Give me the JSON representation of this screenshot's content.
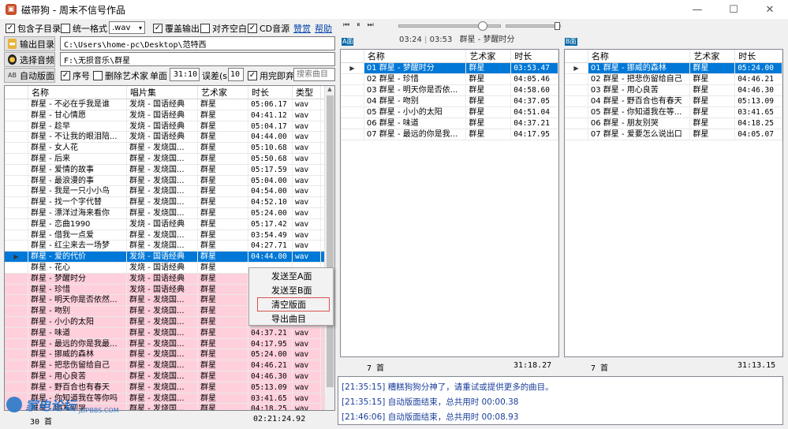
{
  "window": {
    "title": "磁带狗 - 周末不信号作品",
    "app_icon": "cassette-icon",
    "controls": [
      "—",
      "☐",
      "✕"
    ]
  },
  "options": {
    "include_subdir": {
      "label": "包含子目录",
      "checked": true
    },
    "unify_format": {
      "label": "统一格式",
      "checked": false
    },
    "format_value": ".wav",
    "overwrite_output": {
      "label": "覆盖输出",
      "checked": true
    },
    "align_blank": {
      "label": "对齐空白",
      "checked": false
    },
    "cd_source": {
      "label": "CD音源",
      "checked": true
    },
    "donate_link": "赞赏",
    "help_link": "帮助"
  },
  "paths": {
    "output_button": "输出目录",
    "output_path": "C:\\Users\\home-pc\\Desktop\\范特西",
    "source_button": "选择音频",
    "source_path": "F:\\无损音乐\\群星"
  },
  "auto": {
    "button": "自动版面",
    "serial": {
      "label": "序号",
      "checked": true
    },
    "remove_artist": {
      "label": "删除艺术家",
      "checked": false
    },
    "side_label": "单面",
    "side_value": "31:10",
    "error_label": "误差(s)",
    "error_value": "10",
    "discard": {
      "label": "用完即弃",
      "checked": true
    },
    "search_placeholder": "搜索曲目"
  },
  "player": {
    "current_time": "03:24",
    "total_time": "03:53",
    "now_playing": "群星 - 梦醒时分",
    "progress": 0.85,
    "volume": 0.97
  },
  "library": {
    "columns": [
      "名称",
      "唱片集",
      "艺术家",
      "时长",
      "类型"
    ],
    "rows": [
      {
        "name": "群星 - 不必在乎我是谁",
        "album": "发烧 - 国语经典",
        "artist": "群星",
        "duration": "05:06.17",
        "type": "wav",
        "state": "normal"
      },
      {
        "name": "群星 - 甘心情愿",
        "album": "发烧 - 国语经典",
        "artist": "群星",
        "duration": "04:41.12",
        "type": "wav",
        "state": "normal"
      },
      {
        "name": "群星 - 趁早",
        "album": "发烧 - 国语经典",
        "artist": "群星",
        "duration": "05:04.17",
        "type": "wav",
        "state": "normal"
      },
      {
        "name": "群星 - 不让我的眼泪陪...",
        "album": "发烧 - 国语经典",
        "artist": "群星",
        "duration": "04:44.00",
        "type": "wav",
        "state": "normal"
      },
      {
        "name": "群星 - 女人花",
        "album": "群星 - 发烧国...",
        "artist": "群星",
        "duration": "05:10.68",
        "type": "wav",
        "state": "normal"
      },
      {
        "name": "群星 - 后来",
        "album": "群星 - 发烧国...",
        "artist": "群星",
        "duration": "05:50.68",
        "type": "wav",
        "state": "normal"
      },
      {
        "name": "群星 - 爱情的故事",
        "album": "群星 - 发烧国...",
        "artist": "群星",
        "duration": "05:17.59",
        "type": "wav",
        "state": "normal"
      },
      {
        "name": "群星 - 最浪漫的事",
        "album": "群星 - 发烧国...",
        "artist": "群星",
        "duration": "05:04.00",
        "type": "wav",
        "state": "normal"
      },
      {
        "name": "群星 - 我是一只小小鸟",
        "album": "群星 - 发烧国...",
        "artist": "群星",
        "duration": "04:54.00",
        "type": "wav",
        "state": "normal"
      },
      {
        "name": "群星 - 找一个字代替",
        "album": "群星 - 发烧国...",
        "artist": "群星",
        "duration": "04:52.10",
        "type": "wav",
        "state": "normal"
      },
      {
        "name": "群星 - 漂洋过海来看你",
        "album": "群星 - 发烧国...",
        "artist": "群星",
        "duration": "05:24.00",
        "type": "wav",
        "state": "normal"
      },
      {
        "name": "群星 - 恋曲1990",
        "album": "发烧 - 国语经典",
        "artist": "群星",
        "duration": "05:17.42",
        "type": "wav",
        "state": "normal"
      },
      {
        "name": "群星 - 借我一点爱",
        "album": "群星 - 发烧国...",
        "artist": "群星",
        "duration": "03:54.49",
        "type": "wav",
        "state": "normal"
      },
      {
        "name": "群星 - 红尘来去一场梦",
        "album": "群星 - 发烧国...",
        "artist": "群星",
        "duration": "04:27.71",
        "type": "wav",
        "state": "normal"
      },
      {
        "name": "群星 - 爱的代价",
        "album": "发烧 - 国语经典",
        "artist": "群星",
        "duration": "04:44.00",
        "type": "wav",
        "state": "selected"
      },
      {
        "name": "群星 - 花心",
        "album": "发烧 - 国语经典",
        "artist": "群星",
        "duration": "",
        "type": "",
        "state": "normal"
      },
      {
        "name": "群星 - 梦醒时分",
        "album": "发烧 - 国语经典",
        "artist": "群星",
        "duration": "",
        "type": "",
        "state": "pink"
      },
      {
        "name": "群星 - 珍惜",
        "album": "发烧 - 国语经典",
        "artist": "群星",
        "duration": "",
        "type": "",
        "state": "pink"
      },
      {
        "name": "群星 - 明天你是否依然...",
        "album": "群星 - 发烧国...",
        "artist": "群星",
        "duration": "",
        "type": "",
        "state": "pink"
      },
      {
        "name": "群星 - 吻别",
        "album": "群星 - 发烧国...",
        "artist": "群星",
        "duration": "",
        "type": "",
        "state": "pink"
      },
      {
        "name": "群星 - 小小的太阳",
        "album": "群星 - 发烧国...",
        "artist": "群星",
        "duration": "",
        "type": "",
        "state": "pink"
      },
      {
        "name": "群星 - 味道",
        "album": "群星 - 发烧国...",
        "artist": "群星",
        "duration": "04:37.21",
        "type": "wav",
        "state": "pink"
      },
      {
        "name": "群星 - 最远的你是我最...",
        "album": "群星 - 发烧国...",
        "artist": "群星",
        "duration": "04:17.95",
        "type": "wav",
        "state": "pink"
      },
      {
        "name": "群星 - 挪威的森林",
        "album": "群星 - 发烧国...",
        "artist": "群星",
        "duration": "05:24.00",
        "type": "wav",
        "state": "pink"
      },
      {
        "name": "群星 - 把悲伤留给自己",
        "album": "群星 - 发烧国...",
        "artist": "群星",
        "duration": "04:46.21",
        "type": "wav",
        "state": "pink"
      },
      {
        "name": "群星 - 用心良苦",
        "album": "群星 - 发烧国...",
        "artist": "群星",
        "duration": "04:46.30",
        "type": "wav",
        "state": "pink"
      },
      {
        "name": "群星 - 野百合也有春天",
        "album": "群星 - 发烧国...",
        "artist": "群星",
        "duration": "05:13.09",
        "type": "wav",
        "state": "pink"
      },
      {
        "name": "群星 - 你知道我在等你吗",
        "album": "群星 - 发烧国...",
        "artist": "群星",
        "duration": "03:41.65",
        "type": "wav",
        "state": "pink"
      },
      {
        "name": "群星 - 朋友别哭",
        "album": "群星 - 发烧国...",
        "artist": "群星",
        "duration": "04:18.25",
        "type": "wav",
        "state": "pink"
      }
    ],
    "footer_count": "30 首",
    "footer_total": "02:21:24.92"
  },
  "context_menu": {
    "items": [
      "发送至A面",
      "发送至B面",
      "清空版面",
      "导出曲目"
    ],
    "highlighted": 2
  },
  "side_a": {
    "label": "A面",
    "columns": [
      "名称",
      "艺术家",
      "时长"
    ],
    "rows": [
      {
        "name": "01 群星 - 梦醒时分",
        "artist": "群星",
        "duration": "03:53.47",
        "selected": true
      },
      {
        "name": "02 群星 - 珍惜",
        "artist": "群星",
        "duration": "04:05.46",
        "selected": false
      },
      {
        "name": "03 群星 - 明天你是否依...",
        "artist": "群星",
        "duration": "04:58.60",
        "selected": false
      },
      {
        "name": "04 群星 - 吻别",
        "artist": "群星",
        "duration": "04:37.05",
        "selected": false
      },
      {
        "name": "05 群星 - 小小的太阳",
        "artist": "群星",
        "duration": "04:51.04",
        "selected": false
      },
      {
        "name": "06 群星 - 味道",
        "artist": "群星",
        "duration": "04:37.21",
        "selected": false
      },
      {
        "name": "07 群星 - 最远的你是我...",
        "artist": "群星",
        "duration": "04:17.95",
        "selected": false
      }
    ],
    "footer_count": "7 首",
    "footer_total": "31:18.27"
  },
  "side_b": {
    "label": "B面",
    "columns": [
      "名称",
      "艺术家",
      "时长"
    ],
    "rows": [
      {
        "name": "01 群星 - 挪威的森林",
        "artist": "群星",
        "duration": "05:24.00",
        "selected": true
      },
      {
        "name": "02 群星 - 把悲伤留给自己",
        "artist": "群星",
        "duration": "04:46.21",
        "selected": false
      },
      {
        "name": "03 群星 - 用心良苦",
        "artist": "群星",
        "duration": "04:46.30",
        "selected": false
      },
      {
        "name": "04 群星 - 野百合也有春天",
        "artist": "群星",
        "duration": "05:13.09",
        "selected": false
      },
      {
        "name": "05 群星 - 你知道我在等...",
        "artist": "群星",
        "duration": "03:41.65",
        "selected": false
      },
      {
        "name": "06 群星 - 朋友别哭",
        "artist": "群星",
        "duration": "04:18.25",
        "selected": false
      },
      {
        "name": "07 群星 - 爱要怎么说出口",
        "artist": "群星",
        "duration": "04:05.07",
        "selected": false
      }
    ],
    "footer_count": "7 首",
    "footer_total": "31:13.15"
  },
  "log": [
    "[21:35:15] 糟糕狗狗分神了，请重试或提供更多的曲目。",
    "[21:35:15] 自动版面结束，总共用时 00:00.38",
    "[21:46:06] 自动版面结束，总共用时 00:08.93"
  ],
  "watermark": {
    "text": "家电论坛",
    "sub": "JDPBBS.COM"
  },
  "colors": {
    "selection": "#0078d7",
    "pink_row": "#ffd0dc",
    "log_text": "#1b3f9c",
    "link": "#0645ad"
  }
}
